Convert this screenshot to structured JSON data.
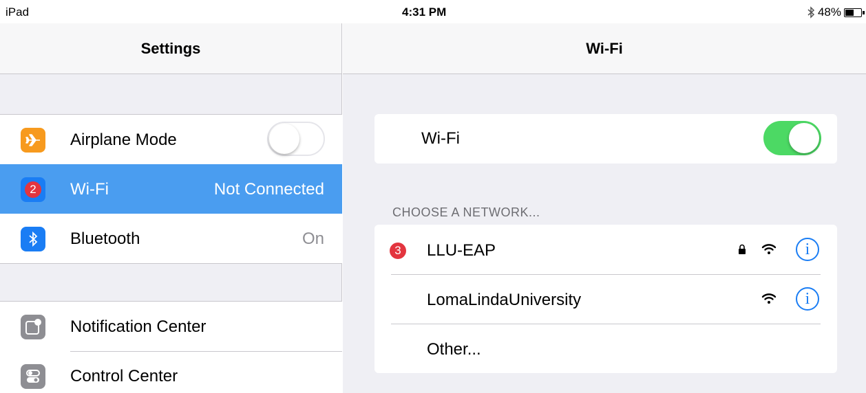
{
  "status_bar": {
    "device": "iPad",
    "time": "4:31 PM",
    "battery_percent": "48%",
    "battery_level": 0.48
  },
  "left": {
    "nav_title": "Settings",
    "group1": [
      {
        "label": "Airplane Mode",
        "icon": "airplane-icon",
        "toggle": "off"
      },
      {
        "label": "Wi-Fi",
        "value": "Not Connected",
        "icon": "wifi-icon",
        "badge": "2",
        "selected": true
      },
      {
        "label": "Bluetooth",
        "value": "On",
        "icon": "bluetooth-icon"
      }
    ],
    "group2": [
      {
        "label": "Notification Center",
        "icon": "notification-center-icon"
      },
      {
        "label": "Control Center",
        "icon": "control-center-icon"
      }
    ]
  },
  "right": {
    "nav_title": "Wi-Fi",
    "wifi_toggle_label": "Wi-Fi",
    "wifi_toggle": "on",
    "section_header": "CHOOSE A NETWORK...",
    "networks": [
      {
        "name": "LLU-EAP",
        "badge": "3",
        "locked": true
      },
      {
        "name": "LomaLindaUniversity",
        "locked": false
      },
      {
        "name": "Other..."
      }
    ]
  },
  "colors": {
    "selected_row": "#4a9df0",
    "toggle_on": "#4cd964",
    "badge_red": "#e3353f",
    "ios_blue": "#1a7df4",
    "airplane_orange": "#f79a1e"
  }
}
